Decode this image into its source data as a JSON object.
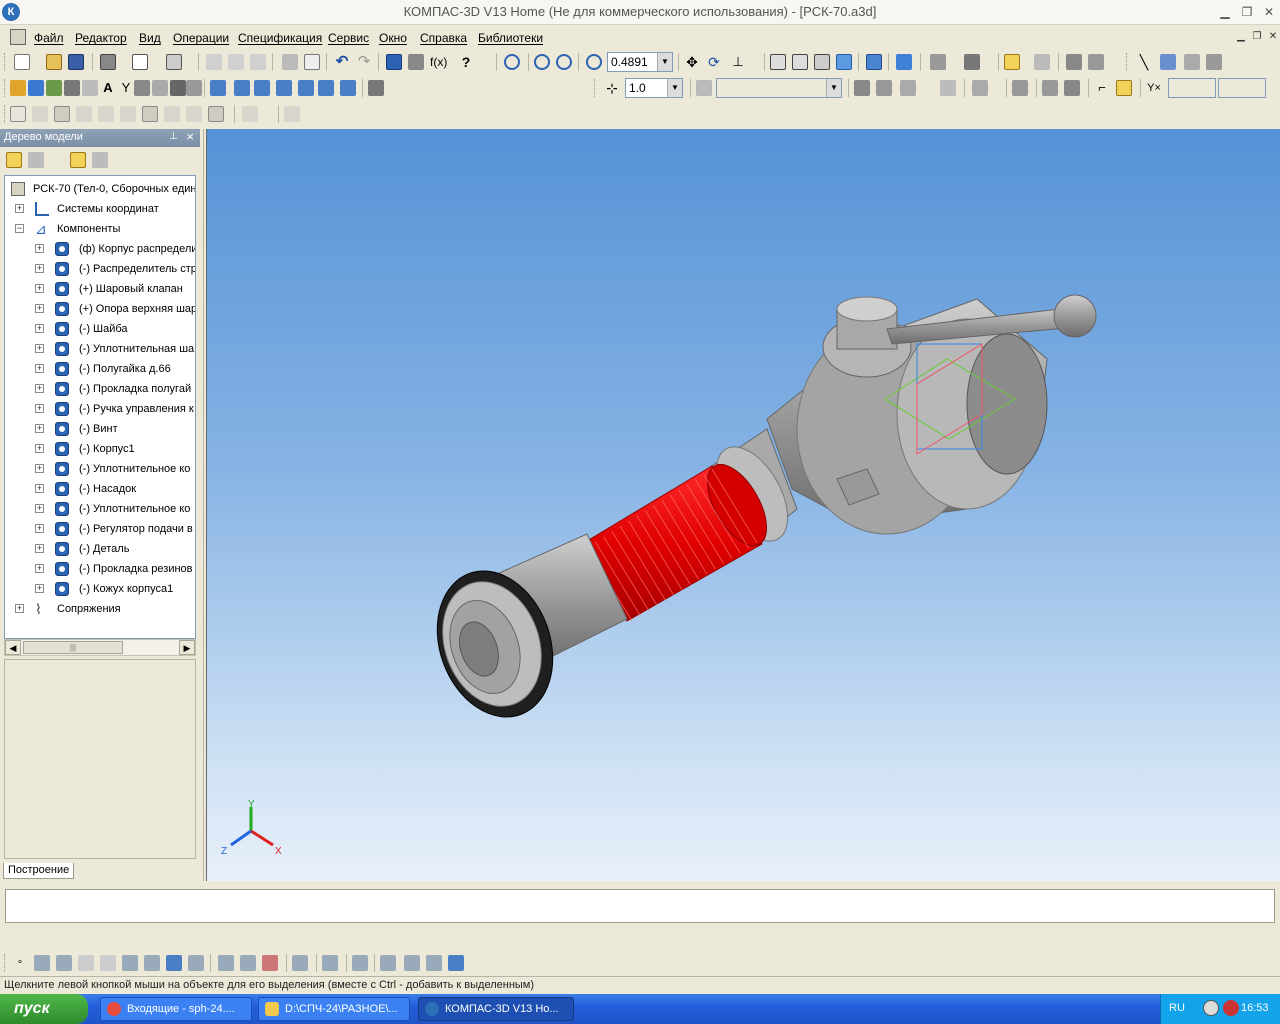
{
  "window": {
    "title": "КОМПАС-3D V13 Home (Не для коммерческого использования) - [РСК-70.a3d]",
    "logo": "К"
  },
  "menu": {
    "items": [
      "Файл",
      "Редактор",
      "Вид",
      "Операции",
      "Спецификация",
      "Сервис",
      "Окно",
      "Справка",
      "Библиотеки"
    ]
  },
  "toolbar": {
    "zoom_value": "0.4891",
    "step_value": "1.0",
    "style_value": ""
  },
  "tree": {
    "title": "Дерево модели",
    "root": "РСК-70 (Тел-0, Сборочных един",
    "coord_systems": "Системы координат",
    "components_label": "Компоненты",
    "components": [
      "(ф) Корпус распредели",
      "(-) Распределитель стр",
      "(+) Шаровый клапан",
      "(+) Опора верхняя шар",
      "(-) Шайба",
      "(-) Уплотнительная ша",
      "(-) Полугайка д.66",
      "(-) Прокладка полугай",
      "(-) Ручка управления к",
      "(-) Винт",
      "(-) Корпус1",
      "(-) Уплотнительное ко",
      "(-) Насадок",
      "(-) Уплотнительное ко",
      "(-) Регулятор подачи в",
      "(-) Деталь",
      "(-) Прокладка резинов",
      "(-) Кожух корпуса1"
    ],
    "mates": "Сопряжения",
    "tab": "Построение"
  },
  "viewport": {
    "axis_labels": {
      "x": "X",
      "y": "Y",
      "z": "Z"
    },
    "colors": {
      "highlight": "#ee0000",
      "metal": "#9a9a9a",
      "background_top": "#5592d6"
    }
  },
  "status": {
    "hint": "Щелкните левой кнопкой мыши на объекте для его выделения (вместе с Ctrl - добавить к выделенным)"
  },
  "taskbar": {
    "start": "пуск",
    "tasks": [
      "Входящие - sph-24....",
      "D:\\СПЧ-24\\РАЗНОЕ\\...",
      "КОМПАС-3D V13 Ho..."
    ],
    "lang": "RU",
    "clock": "16:53"
  }
}
